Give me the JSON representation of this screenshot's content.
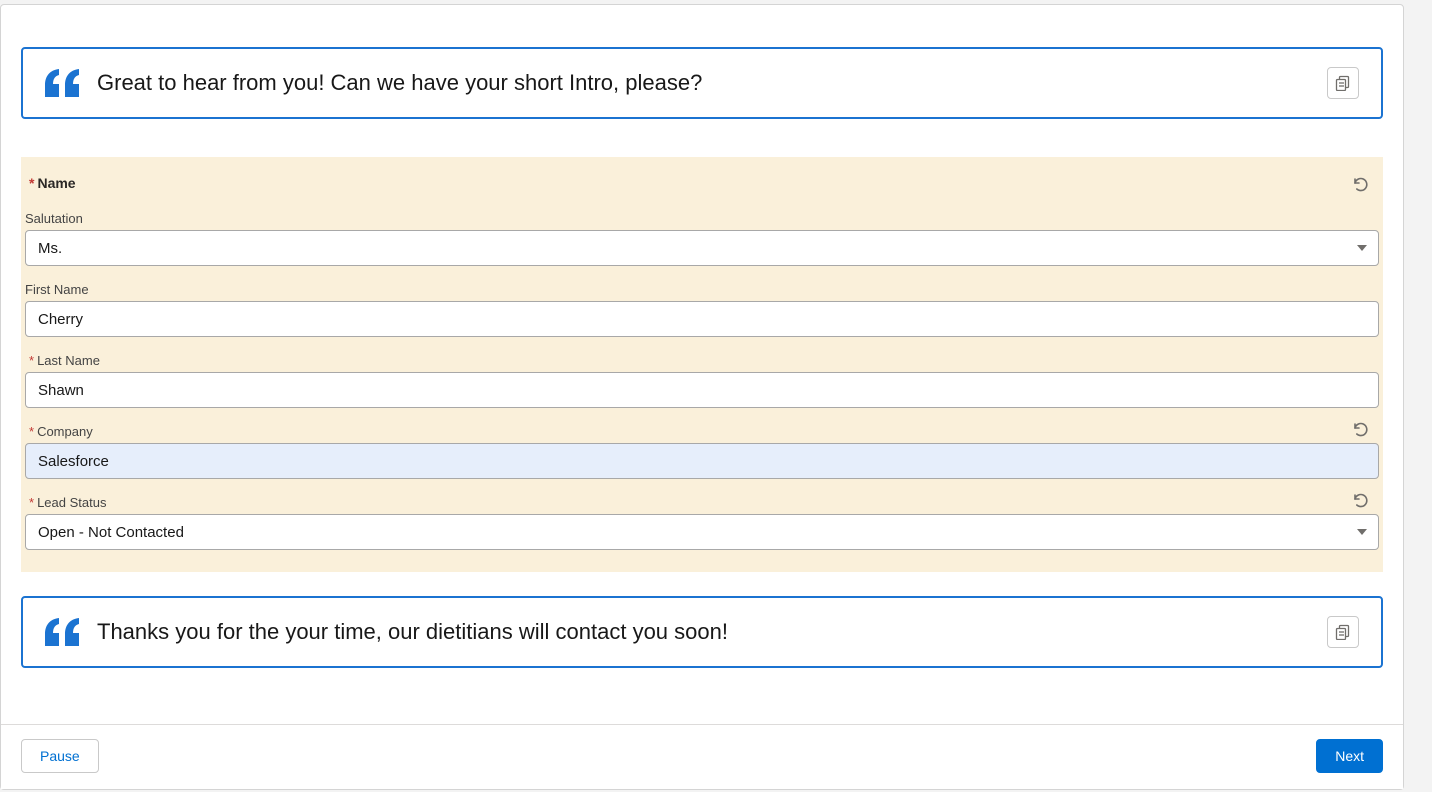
{
  "intro_quote": "Great to hear from you! Can we have your short Intro, please?",
  "form": {
    "name_label": "Name",
    "salutation_label": "Salutation",
    "salutation_value": "Ms.",
    "first_name_label": "First Name",
    "first_name_value": "Cherry",
    "last_name_label": "Last Name",
    "last_name_value": "Shawn",
    "company_label": "Company",
    "company_value": "Salesforce",
    "lead_status_label": "Lead Status",
    "lead_status_value": "Open - Not Contacted"
  },
  "outro_quote": "Thanks you for the your time, our dietitians will contact you soon!",
  "footer": {
    "pause_label": "Pause",
    "next_label": "Next"
  }
}
